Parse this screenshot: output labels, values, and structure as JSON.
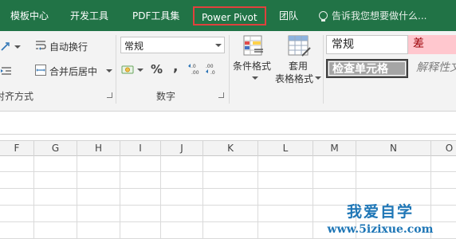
{
  "ribbon_tabs": [
    {
      "label": "模板中心"
    },
    {
      "label": "开发工具"
    },
    {
      "label": "PDF工具集"
    },
    {
      "label": "Power Pivot"
    },
    {
      "label": "团队"
    }
  ],
  "tell_me": {
    "text": "告诉我您想要做什么..."
  },
  "alignment_group": {
    "wrap_text_label": "自动换行",
    "merge_center_label": "合并后居中",
    "group_label": "对齐方式"
  },
  "number_group": {
    "format_value": "常规",
    "percent_symbol": "%",
    "comma_symbol": ",",
    "group_label": "数字"
  },
  "styles_group": {
    "conditional_format_label": "条件格式",
    "table_format_label_line1": "套用",
    "table_format_label_line2": "表格格式",
    "cell_styles": {
      "normal": "常规",
      "bad": "差",
      "check_cell": "检查单元格",
      "explanatory": "解释性文"
    }
  },
  "columns": [
    "F",
    "G",
    "H",
    "I",
    "J",
    "K",
    "L",
    "M",
    "N",
    "O"
  ],
  "watermark": {
    "title": "我爱自学",
    "url": "www.5izixue.com"
  },
  "colors": {
    "ribbon_green": "#217346",
    "highlight_red": "#e0413d",
    "bad_fill": "#ffc7ce",
    "bad_text": "#9c0006",
    "watermark_blue": "#1e76b6"
  }
}
